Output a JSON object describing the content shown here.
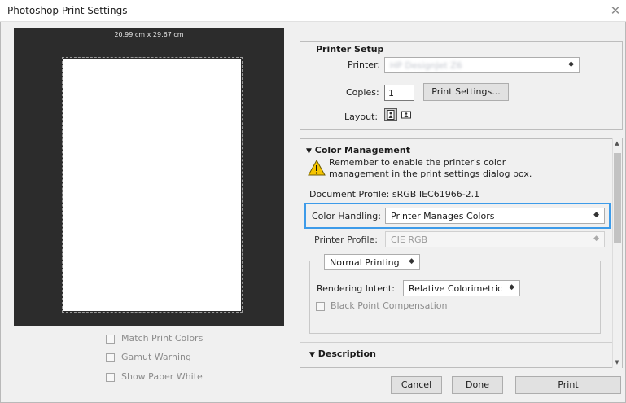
{
  "window": {
    "title": "Photoshop Print Settings",
    "close_glyph": "✕"
  },
  "preview": {
    "size_label": "20.99 cm x 29.67 cm"
  },
  "options": [
    {
      "label": "Match Print Colors"
    },
    {
      "label": "Gamut Warning"
    },
    {
      "label": "Show Paper White"
    }
  ],
  "printer_setup": {
    "header": "Printer Setup",
    "printer_label": "Printer:",
    "printer_value": "HP DesignJet Z6",
    "copies_label": "Copies:",
    "copies_value": "1",
    "print_settings_button": "Print Settings...",
    "layout_label": "Layout:"
  },
  "color_management": {
    "header": "Color Management",
    "warning_line1": "Remember to enable the printer's color",
    "warning_line2": "management in the print settings dialog box.",
    "document_profile": "Document Profile: sRGB IEC61966-2.1",
    "color_handling_label": "Color Handling:",
    "color_handling_value": "Printer Manages Colors",
    "printer_profile_label": "Printer Profile:",
    "printer_profile_value": "CIE RGB",
    "normal_printing": "Normal Printing",
    "rendering_intent_label": "Rendering Intent:",
    "rendering_intent_value": "Relative Colorimetric",
    "black_point_label": "Black Point Compensation"
  },
  "description": {
    "header": "Description"
  },
  "buttons": {
    "cancel": "Cancel",
    "done": "Done",
    "print": "Print"
  },
  "colors": {
    "highlight": "#3d9be9",
    "preview_bg": "#2c2c2c",
    "warning_yellow": "#f5c400"
  }
}
